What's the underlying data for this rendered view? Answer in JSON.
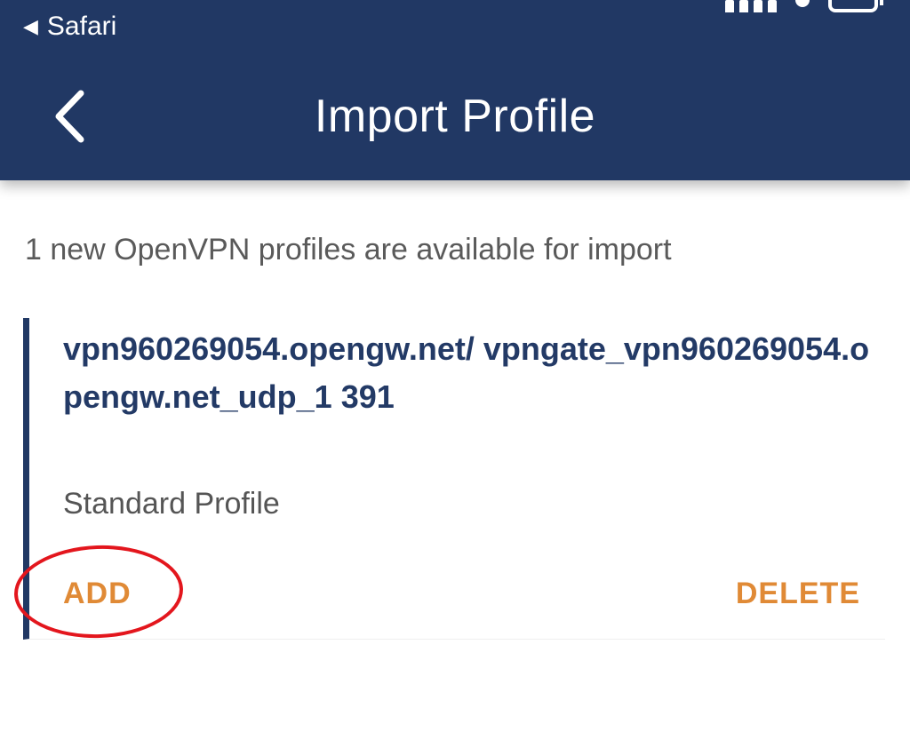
{
  "status_bar": {
    "back_app_label": "Safari",
    "back_arrow_glyph": "◀",
    "icons": [
      "signal-icon",
      "wifi-icon",
      "battery-icon"
    ]
  },
  "nav": {
    "title": "Import Profile",
    "back_icon": "chevron-left-icon"
  },
  "content": {
    "info_text": "1 new OpenVPN profiles are available for import",
    "profiles": [
      {
        "url": "vpn960269054.opengw.net/ vpngate_vpn960269054.opengw.net_udp_1 391",
        "type": "Standard Profile",
        "add_label": "ADD",
        "delete_label": "DELETE"
      }
    ]
  },
  "colors": {
    "header_bg": "#213864",
    "accent": "#e08a36",
    "profile_text": "#233a66",
    "annotation": "#e3161d"
  }
}
